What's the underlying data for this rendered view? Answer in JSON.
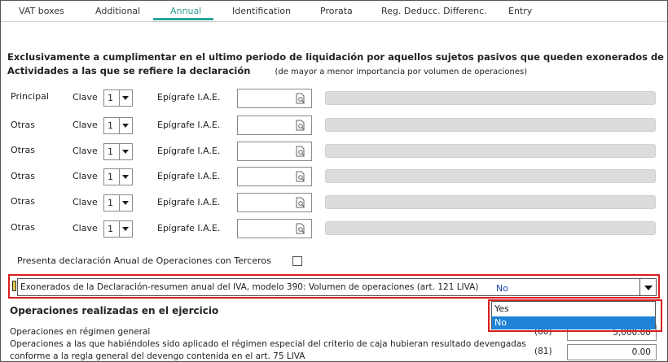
{
  "tabs": [
    {
      "label": "VAT boxes"
    },
    {
      "label": "Additional"
    },
    {
      "label": "Annual"
    },
    {
      "label": "Identification"
    },
    {
      "label": "Prorata"
    },
    {
      "label": "Reg. Deducc. Differenc."
    },
    {
      "label": "Entry"
    }
  ],
  "header": {
    "title_line1": "Exclusivamente a cumplimentar en el ultimo periodo de liquidación por aquellos sujetos pasivos que queden exonerados de la",
    "title_line2": "Actividades a las que se refiere la declaración",
    "subtitle": "(de mayor a menor importancia por volumen de operaciones)"
  },
  "activity_rows": [
    {
      "label": "Principal",
      "clave_label": "Clave",
      "clave_value": "1",
      "epigrafe_label": "Epígrafe I.A.E."
    },
    {
      "label": "Otras",
      "clave_label": "Clave",
      "clave_value": "1",
      "epigrafe_label": "Epígrafe I.A.E."
    },
    {
      "label": "Otras",
      "clave_label": "Clave",
      "clave_value": "1",
      "epigrafe_label": "Epígrafe I.A.E."
    },
    {
      "label": "Otras",
      "clave_label": "Clave",
      "clave_value": "1",
      "epigrafe_label": "Epígrafe I.A.E."
    },
    {
      "label": "Otras",
      "clave_label": "Clave",
      "clave_value": "1",
      "epigrafe_label": "Epígrafe I.A.E."
    },
    {
      "label": "Otras",
      "clave_label": "Clave",
      "clave_value": "1",
      "epigrafe_label": "Epígrafe I.A.E."
    }
  ],
  "terceros": {
    "label": "Presenta declaración Anual de Operaciones con Terceros",
    "checked": false
  },
  "exonerados": {
    "label": "Exonerados de la Declaración-resumen anual del IVA, modelo 390: Volumen de operaciones (art. 121 LIVA)",
    "selected": "No",
    "options": [
      "Yes",
      "No"
    ]
  },
  "operaciones": {
    "title": "Operaciones realizadas en el ejercicio",
    "rows": [
      {
        "label": "Operaciones en régimen general",
        "code": "(80)",
        "amount": "5,000.00"
      },
      {
        "label_line1": "Operaciones a las que habiéndoles sido aplicado el régimen especial del criterio de caja hubieran resultado devengadas",
        "label_line2": "conforme a la regla general del devengo contenida en el art. 75 LIVA",
        "code": "(81)",
        "amount": "0.00"
      }
    ]
  },
  "colors": {
    "accent": "#2ba59c",
    "highlight_border": "#d81e1e",
    "selection": "#1e82d6",
    "selected_value": "#1c3fae"
  }
}
